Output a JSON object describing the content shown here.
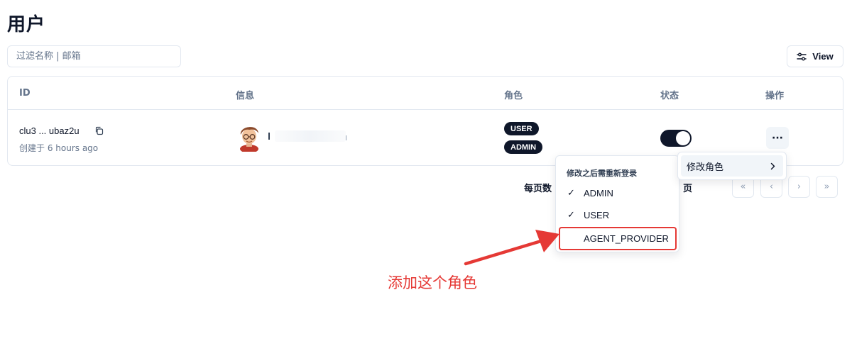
{
  "page": {
    "title": "用户"
  },
  "filter": {
    "placeholder": "过滤名称 | 邮箱"
  },
  "toolbar": {
    "view_label": "View",
    "view_icon": "sliders-icon"
  },
  "table": {
    "columns": [
      "ID",
      "信息",
      "角色",
      "状态",
      "操作"
    ],
    "rows": [
      {
        "id": "clu3 ... ubaz2u",
        "created": "创建于 6 hours ago",
        "info_prefix": "i",
        "roles": [
          "USER",
          "ADMIN"
        ],
        "status_enabled": true,
        "actions_label": "···"
      }
    ]
  },
  "action_menu": {
    "item_label": "修改角色",
    "submenu_header": "修改之后需重新登录",
    "roles": [
      {
        "label": "ADMIN",
        "checked": true
      },
      {
        "label": "USER",
        "checked": true
      },
      {
        "label": "AGENT_PROVIDER",
        "checked": false
      }
    ]
  },
  "pagination": {
    "per_page_label": "每页数",
    "page_suffix": "页",
    "first": "«",
    "prev": "‹",
    "next": "›",
    "last": "»"
  },
  "annotation": {
    "text": "添加这个角色",
    "color": "#e53935"
  },
  "colors": {
    "primary": "#0f172a",
    "border": "#e2e8f0",
    "muted": "#64748b",
    "highlight": "#e53935"
  }
}
